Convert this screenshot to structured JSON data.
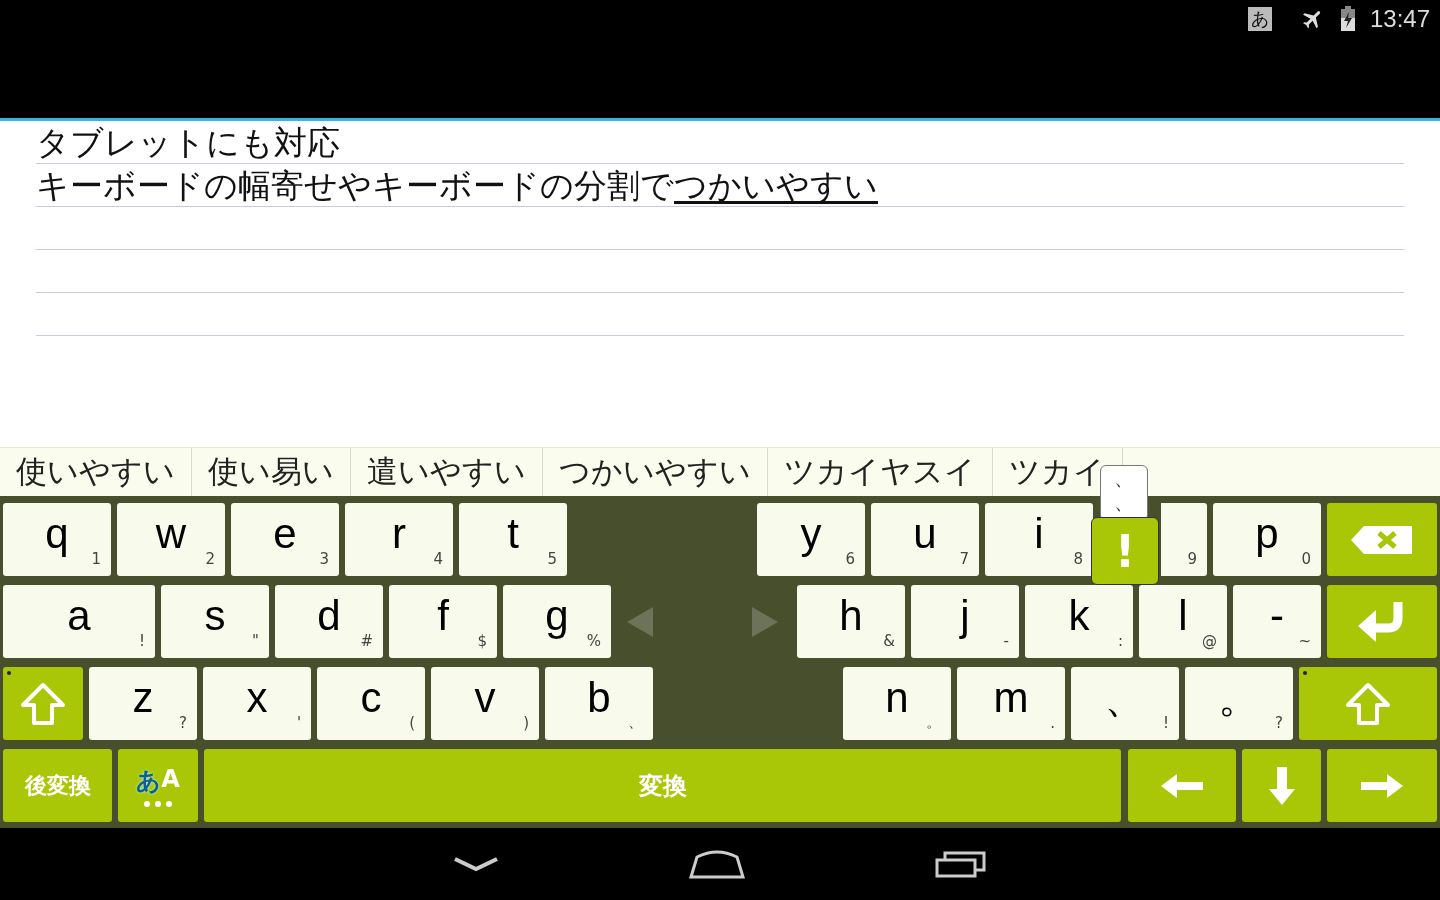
{
  "status_bar": {
    "input_indicator": "あ",
    "time": "13:47"
  },
  "editor": {
    "lines": [
      {
        "text": "タブレットにも対応"
      },
      {
        "text": "キーボードの幅寄せやキーボードの分割で",
        "composing": "つかいやすい"
      }
    ]
  },
  "candidates": [
    "使いやすい",
    "使い易い",
    "遣いやすい",
    "つかいやすい",
    "ツカイヤスイ",
    "ツカイ"
  ],
  "keyboard": {
    "rows": [
      {
        "left": [
          {
            "kind": "letter",
            "label": "q",
            "hint": "1"
          },
          {
            "kind": "letter",
            "label": "w",
            "hint": "2"
          },
          {
            "kind": "letter",
            "label": "e",
            "hint": "3"
          },
          {
            "kind": "letter",
            "label": "r",
            "hint": "4"
          },
          {
            "kind": "letter",
            "label": "t",
            "hint": "5"
          }
        ],
        "right": [
          {
            "kind": "letter",
            "label": "y",
            "hint": "6"
          },
          {
            "kind": "letter",
            "label": "u",
            "hint": "7"
          },
          {
            "kind": "letter",
            "label": "i",
            "hint": "8"
          },
          {
            "kind": "letter",
            "hint": "9"
          },
          {
            "kind": "letter",
            "label": "p",
            "hint": "0"
          },
          {
            "kind": "backspace"
          }
        ]
      },
      {
        "left": [
          {
            "kind": "letter",
            "label": "a",
            "hint": "!"
          },
          {
            "kind": "letter",
            "label": "s",
            "hint": "\""
          },
          {
            "kind": "letter",
            "label": "d",
            "hint": "#"
          },
          {
            "kind": "letter",
            "label": "f",
            "hint": "$"
          },
          {
            "kind": "letter",
            "label": "g",
            "hint": "%"
          },
          {
            "kind": "split-left"
          }
        ],
        "right": [
          {
            "kind": "split-right"
          },
          {
            "kind": "letter",
            "label": "h",
            "hint": "&"
          },
          {
            "kind": "letter",
            "label": "j",
            "hint": "-"
          },
          {
            "kind": "letter",
            "label": "k",
            "hint": ":"
          },
          {
            "kind": "letter",
            "label": "l",
            "hint": "@"
          },
          {
            "kind": "letter",
            "label": "-",
            "hint": "~"
          },
          {
            "kind": "enter"
          }
        ]
      },
      {
        "left": [
          {
            "kind": "shift"
          },
          {
            "kind": "letter",
            "label": "z",
            "hint": "?"
          },
          {
            "kind": "letter",
            "label": "x",
            "hint": "'"
          },
          {
            "kind": "letter",
            "label": "c",
            "hint": "("
          },
          {
            "kind": "letter",
            "label": "v",
            "hint": ")"
          },
          {
            "kind": "letter",
            "label": "b",
            "hint": "、"
          }
        ],
        "right": [
          {
            "kind": "letter",
            "label": "n",
            "hint": "。"
          },
          {
            "kind": "letter",
            "label": "m",
            "hint": "."
          },
          {
            "kind": "letter",
            "label": "、",
            "hint": "!"
          },
          {
            "kind": "letter",
            "label": "。",
            "hint": "?"
          },
          {
            "kind": "shift"
          }
        ]
      },
      {
        "left": [
          {
            "kind": "text",
            "label": "後変換"
          },
          {
            "kind": "mode",
            "labels": [
              {
                "text": "あ",
                "selected": true
              },
              {
                "text": "A",
                "selected": false
              }
            ]
          },
          {
            "kind": "space",
            "label": "変換"
          },
          {
            "kind": "left"
          },
          {
            "kind": "down"
          },
          {
            "kind": "right"
          }
        ],
        "right": []
      }
    ],
    "popup": {
      "previews": [
        "、",
        "、"
      ],
      "selected": "!"
    }
  }
}
